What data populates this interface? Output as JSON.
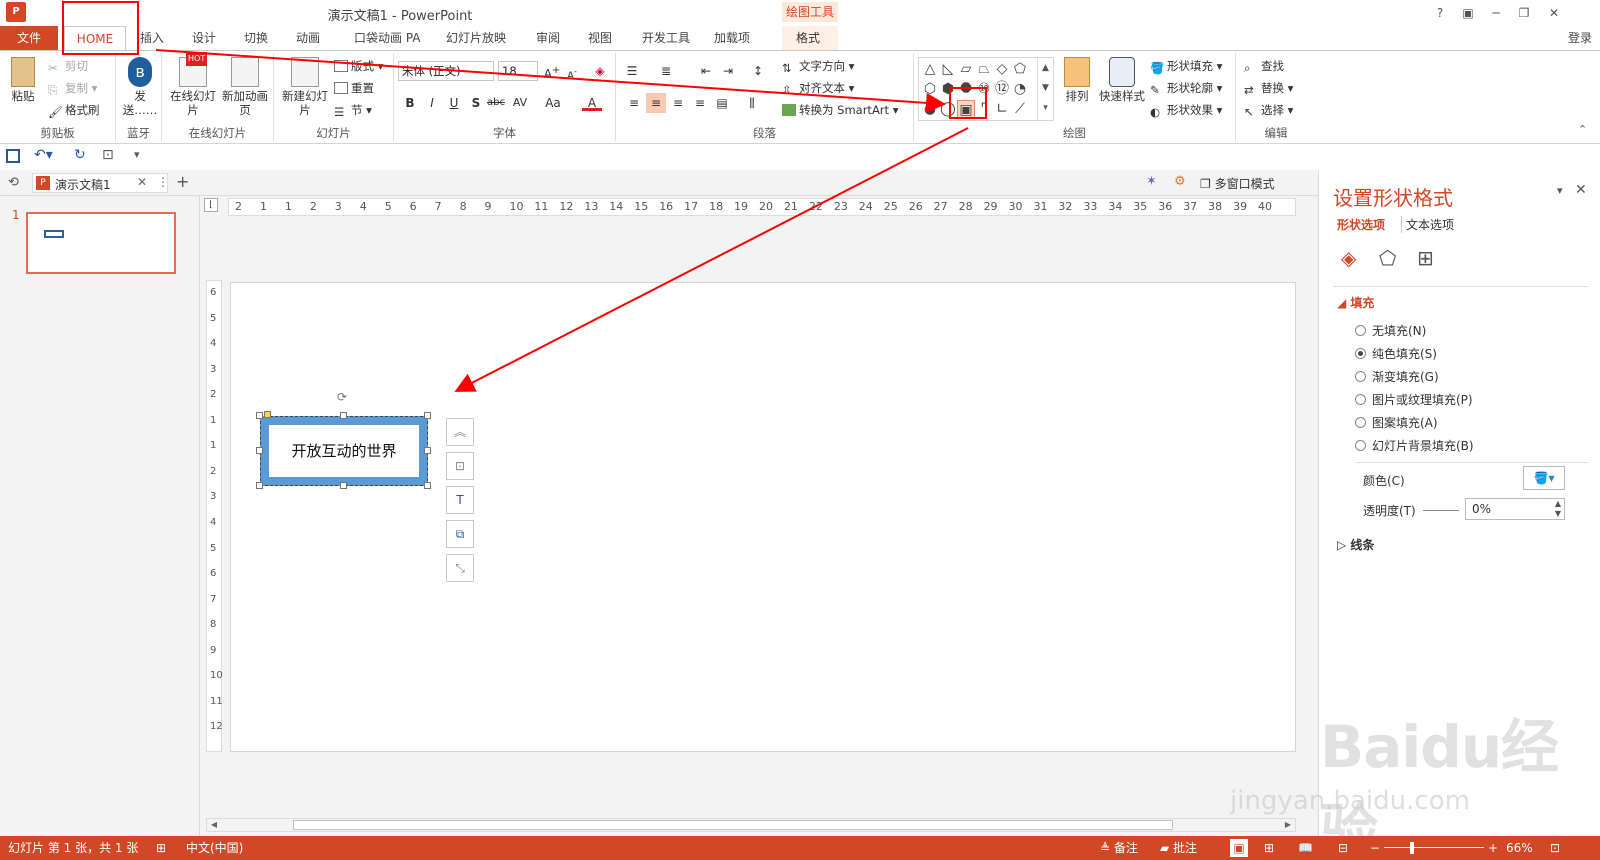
{
  "window": {
    "title": "演示文稿1 - PowerPoint",
    "help": "?",
    "login": "登录"
  },
  "tabs": [
    "文件",
    "HOME",
    "插入",
    "设计",
    "切换",
    "动画",
    "口袋动画 PA",
    "幻灯片放映",
    "审阅",
    "视图",
    "开发工具",
    "加载项",
    "格式"
  ],
  "context_tool": "绘图工具",
  "ribbon": {
    "clipboard": {
      "paste": "粘贴",
      "cut": "剪切",
      "copy": "复制",
      "format_painter": "格式刷",
      "label": "剪贴板"
    },
    "bluetooth": {
      "send": "发送……",
      "label": "蓝牙"
    },
    "online": {
      "online_slides": "在线幻灯片",
      "new_anim": "新加动画页",
      "label": "在线幻灯片",
      "hot": "HOT"
    },
    "slides": {
      "new_slide": "新建幻灯片",
      "layout": "版式",
      "reset": "重置",
      "section": "节",
      "label": "幻灯片"
    },
    "font": {
      "name": "宋体 (正文)",
      "size": "18",
      "label": "字体",
      "aa": "Aa"
    },
    "paragraph": {
      "text_dir": "文字方向",
      "align_text": "对齐文本",
      "smartart": "转换为 SmartArt",
      "label": "段落"
    },
    "drawing": {
      "arrange": "排列",
      "quick_styles": "快速样式",
      "fill": "形状填充",
      "outline": "形状轮廓",
      "effects": "形状效果",
      "label": "绘图"
    },
    "editing": {
      "find": "查找",
      "replace": "替换",
      "select": "选择",
      "label": "编辑"
    }
  },
  "doc_tab": {
    "name": "演示文稿1",
    "multiwindow": "多窗口模式"
  },
  "ruler": {
    "h": [
      "2",
      "1",
      "1",
      "2",
      "3",
      "4",
      "5",
      "6",
      "7",
      "8",
      "9",
      "10",
      "11",
      "12",
      "13",
      "14",
      "15",
      "16",
      "17",
      "18",
      "19",
      "20",
      "21",
      "22",
      "23",
      "24",
      "25",
      "26",
      "27",
      "28",
      "29",
      "30",
      "31",
      "32",
      "33",
      "34",
      "35",
      "36",
      "37",
      "38",
      "39",
      "40"
    ],
    "v": [
      "6",
      "5",
      "4",
      "3",
      "2",
      "1",
      "1",
      "2",
      "3",
      "4",
      "5",
      "6",
      "7",
      "8",
      "9",
      "10",
      "11",
      "12"
    ]
  },
  "thumbnail": {
    "number": "1"
  },
  "slide": {
    "textbox_text": "开放互动的世界"
  },
  "format_pane": {
    "title": "设置形状格式",
    "tab_shape": "形状选项",
    "tab_text": "文本选项",
    "fill_section": "填充",
    "fill_options": [
      "无填充(N)",
      "纯色填充(S)",
      "渐变填充(G)",
      "图片或纹理填充(P)",
      "图案填充(A)",
      "幻灯片背景填充(B)"
    ],
    "selected_fill_index": 1,
    "color_label": "颜色(C)",
    "transparency_label": "透明度(T)",
    "transparency_value": "0%",
    "line_section": "线条"
  },
  "status": {
    "slide_info": "幻灯片 第 1 张，共 1 张",
    "language": "中文(中国)",
    "notes": "备注",
    "comments": "批注",
    "zoom": "66%"
  },
  "watermark": {
    "brand": "Baidu经验",
    "url": "jingyan.baidu.com"
  },
  "colors": {
    "accent": "#d24726",
    "annotation": "#ff0000",
    "shape_fill": "#5b9bd5"
  }
}
